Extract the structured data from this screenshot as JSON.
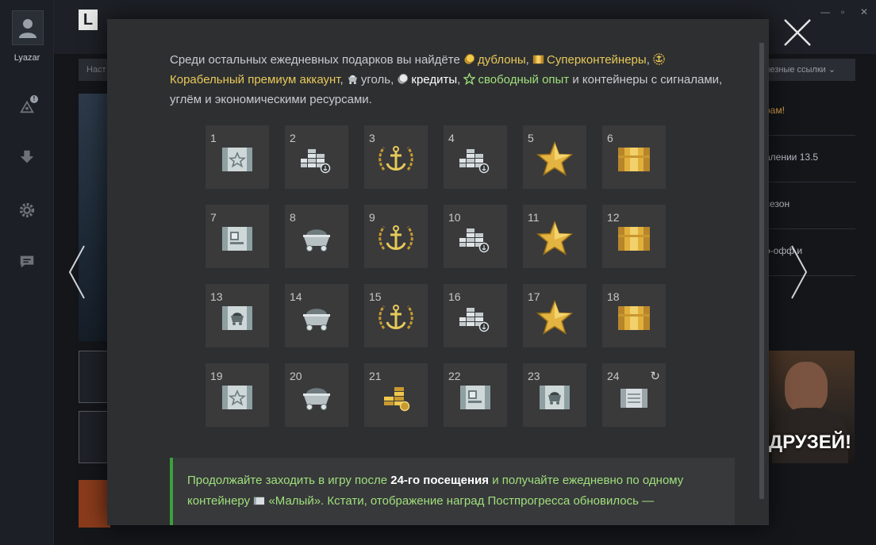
{
  "sidebar": {
    "username": "Lyazar",
    "icons": [
      "avatar-icon",
      "missions-icon",
      "download-icon",
      "settings-icon",
      "chat-icon"
    ],
    "badge": "!"
  },
  "header": {
    "logo": "L",
    "subnav_left": "Наст",
    "subnav_right": "лезные ссылки",
    "window_controls": [
      "—",
      "▫",
      "✕"
    ]
  },
  "news": {
    "items": [
      "рам!",
      "алении 13.5",
      "сезон",
      "о-офф и"
    ],
    "promo_text": "ДРУЗЕЙ!"
  },
  "modal": {
    "intro": {
      "p1": "Среди остальных ежедневных подарков вы найдёте",
      "doubloons": "дублоны",
      "sep1": ",",
      "supercontainers": "Суперконтейнеры",
      "sep2": ",",
      "premium": "Корабельный премиум аккаунт",
      "sep3": ",",
      "coal": "уголь",
      "sep4": ",",
      "credits": "кредиты",
      "sep5": ",",
      "free_xp": "свободный опыт",
      "p2": "и контейнеры с сигналами, углём и экономическими ресурсами."
    },
    "rewards": [
      {
        "day": "1",
        "icon": "star-container-icon"
      },
      {
        "day": "2",
        "icon": "credits-icon"
      },
      {
        "day": "3",
        "icon": "premium-anchor-icon"
      },
      {
        "day": "4",
        "icon": "credits-icon"
      },
      {
        "day": "5",
        "icon": "free-xp-star-icon"
      },
      {
        "day": "6",
        "icon": "supercontainer-icon"
      },
      {
        "day": "7",
        "icon": "signals-container-icon"
      },
      {
        "day": "8",
        "icon": "coal-cart-icon"
      },
      {
        "day": "9",
        "icon": "premium-anchor-icon"
      },
      {
        "day": "10",
        "icon": "credits-icon"
      },
      {
        "day": "11",
        "icon": "free-xp-star-icon"
      },
      {
        "day": "12",
        "icon": "supercontainer-icon"
      },
      {
        "day": "13",
        "icon": "coal-container-icon"
      },
      {
        "day": "14",
        "icon": "coal-cart-icon"
      },
      {
        "day": "15",
        "icon": "premium-anchor-icon"
      },
      {
        "day": "16",
        "icon": "credits-icon"
      },
      {
        "day": "17",
        "icon": "free-xp-star-icon"
      },
      {
        "day": "18",
        "icon": "supercontainer-icon"
      },
      {
        "day": "19",
        "icon": "star-container-icon"
      },
      {
        "day": "20",
        "icon": "coal-cart-icon"
      },
      {
        "day": "21",
        "icon": "doubloons-icon"
      },
      {
        "day": "22",
        "icon": "signals-container-icon"
      },
      {
        "day": "23",
        "icon": "coal-container-icon"
      },
      {
        "day": "24",
        "icon": "small-container-icon",
        "repeat": "↻"
      }
    ],
    "note": {
      "a": "Продолжайте заходить в игру после",
      "b": "24-го посещения",
      "c": "и получайте ежедневно по одному контейнеру",
      "d": "«Малый». Кстати, отображение наград Постпрогресса обновилось —"
    }
  },
  "colors": {
    "gold": "#e7c95a",
    "green": "#9fe07c",
    "accent_bar": "#3ba13b",
    "modal_bg": "#2e2f31",
    "cell_bg": "#3a3a3b"
  }
}
